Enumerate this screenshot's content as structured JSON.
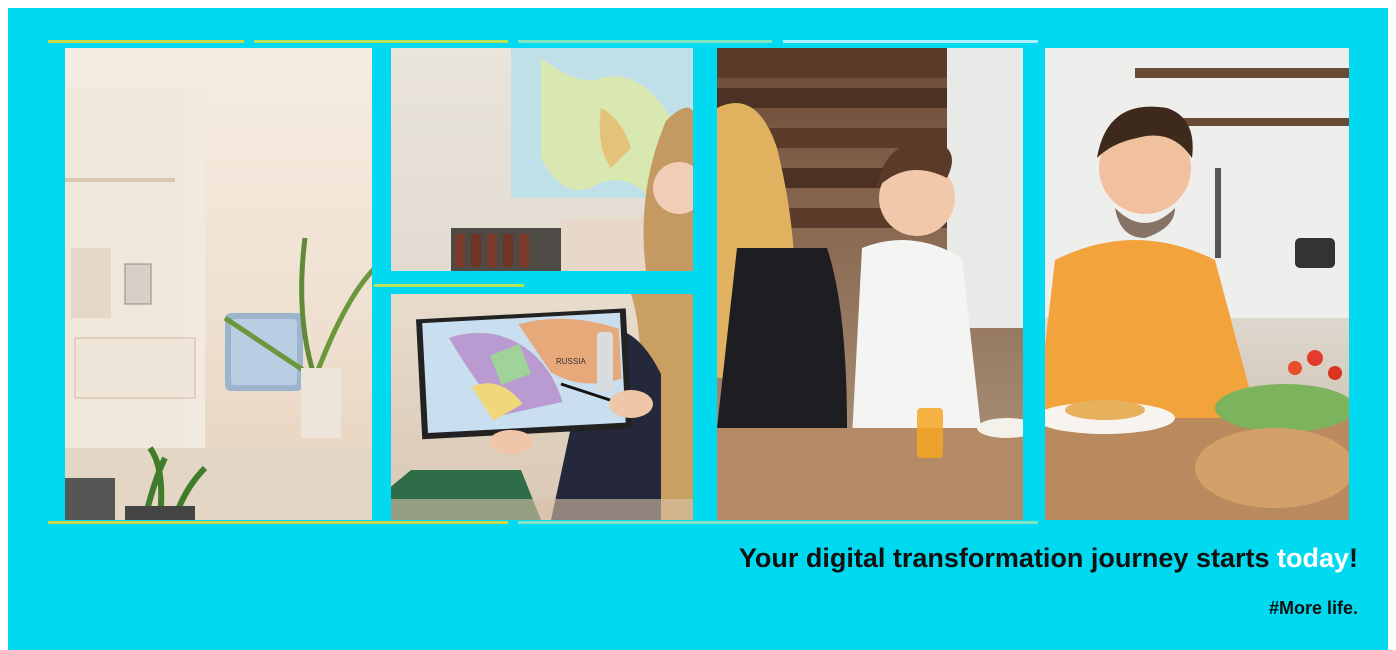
{
  "banner": {
    "background_color": "#00d9f0",
    "headline_before": "Your digital transformation journey starts ",
    "headline_highlight": "today",
    "headline_after": "!",
    "highlight_color": "#ffffff",
    "tagline": "#More life."
  },
  "photo_map": {
    "map_label": "RUSSIA"
  }
}
